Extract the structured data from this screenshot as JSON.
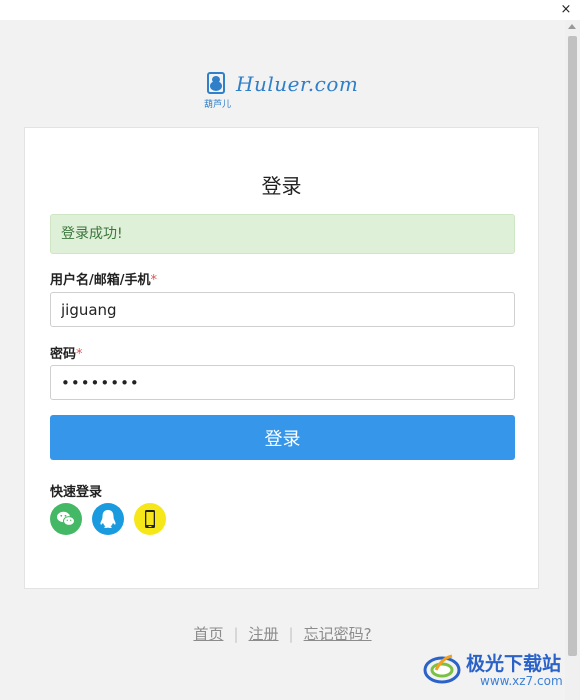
{
  "window": {
    "close_glyph": "×"
  },
  "logo": {
    "wordmark": "Huluer.com",
    "cn_text": "葫芦儿",
    "brand_color": "#2f7fc9"
  },
  "login": {
    "title": "登录",
    "alert_text": "登录成功!",
    "username_label": "用户名/邮箱/手机",
    "username_value": "jiguang",
    "password_label": "密码",
    "password_value": "password",
    "required_mark": "*",
    "submit_label": "登录",
    "quick_login_label": "快速登录",
    "quick_login_icons": [
      "wechat-icon",
      "qq-icon",
      "phone-icon"
    ],
    "accent_color": "#3596ea"
  },
  "footer": {
    "links": [
      "首页",
      "注册",
      "忘记密码?"
    ],
    "separator": "|"
  },
  "watermark": {
    "title": "极光下载站",
    "url": "www.xz7.com"
  }
}
